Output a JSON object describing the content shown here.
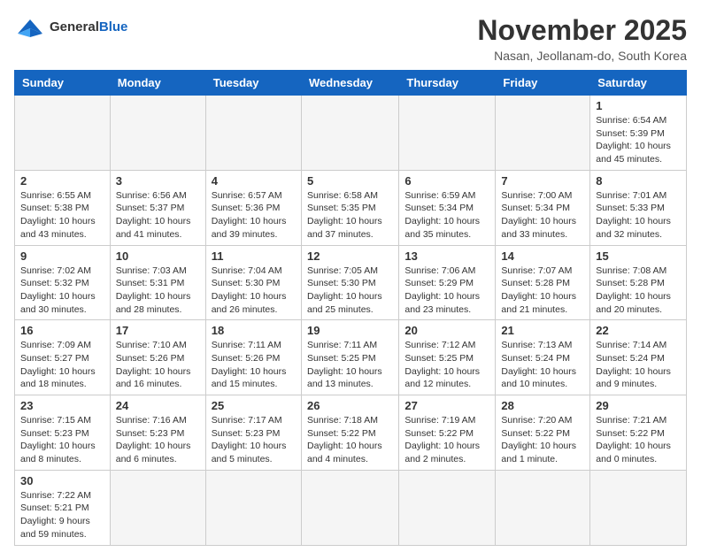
{
  "logo": {
    "text_general": "General",
    "text_blue": "Blue"
  },
  "header": {
    "month_title": "November 2025",
    "subtitle": "Nasan, Jeollanam-do, South Korea"
  },
  "weekdays": [
    "Sunday",
    "Monday",
    "Tuesday",
    "Wednesday",
    "Thursday",
    "Friday",
    "Saturday"
  ],
  "weeks": [
    [
      {
        "day": "",
        "info": ""
      },
      {
        "day": "",
        "info": ""
      },
      {
        "day": "",
        "info": ""
      },
      {
        "day": "",
        "info": ""
      },
      {
        "day": "",
        "info": ""
      },
      {
        "day": "",
        "info": ""
      },
      {
        "day": "1",
        "info": "Sunrise: 6:54 AM\nSunset: 5:39 PM\nDaylight: 10 hours and 45 minutes."
      }
    ],
    [
      {
        "day": "2",
        "info": "Sunrise: 6:55 AM\nSunset: 5:38 PM\nDaylight: 10 hours and 43 minutes."
      },
      {
        "day": "3",
        "info": "Sunrise: 6:56 AM\nSunset: 5:37 PM\nDaylight: 10 hours and 41 minutes."
      },
      {
        "day": "4",
        "info": "Sunrise: 6:57 AM\nSunset: 5:36 PM\nDaylight: 10 hours and 39 minutes."
      },
      {
        "day": "5",
        "info": "Sunrise: 6:58 AM\nSunset: 5:35 PM\nDaylight: 10 hours and 37 minutes."
      },
      {
        "day": "6",
        "info": "Sunrise: 6:59 AM\nSunset: 5:34 PM\nDaylight: 10 hours and 35 minutes."
      },
      {
        "day": "7",
        "info": "Sunrise: 7:00 AM\nSunset: 5:34 PM\nDaylight: 10 hours and 33 minutes."
      },
      {
        "day": "8",
        "info": "Sunrise: 7:01 AM\nSunset: 5:33 PM\nDaylight: 10 hours and 32 minutes."
      }
    ],
    [
      {
        "day": "9",
        "info": "Sunrise: 7:02 AM\nSunset: 5:32 PM\nDaylight: 10 hours and 30 minutes."
      },
      {
        "day": "10",
        "info": "Sunrise: 7:03 AM\nSunset: 5:31 PM\nDaylight: 10 hours and 28 minutes."
      },
      {
        "day": "11",
        "info": "Sunrise: 7:04 AM\nSunset: 5:30 PM\nDaylight: 10 hours and 26 minutes."
      },
      {
        "day": "12",
        "info": "Sunrise: 7:05 AM\nSunset: 5:30 PM\nDaylight: 10 hours and 25 minutes."
      },
      {
        "day": "13",
        "info": "Sunrise: 7:06 AM\nSunset: 5:29 PM\nDaylight: 10 hours and 23 minutes."
      },
      {
        "day": "14",
        "info": "Sunrise: 7:07 AM\nSunset: 5:28 PM\nDaylight: 10 hours and 21 minutes."
      },
      {
        "day": "15",
        "info": "Sunrise: 7:08 AM\nSunset: 5:28 PM\nDaylight: 10 hours and 20 minutes."
      }
    ],
    [
      {
        "day": "16",
        "info": "Sunrise: 7:09 AM\nSunset: 5:27 PM\nDaylight: 10 hours and 18 minutes."
      },
      {
        "day": "17",
        "info": "Sunrise: 7:10 AM\nSunset: 5:26 PM\nDaylight: 10 hours and 16 minutes."
      },
      {
        "day": "18",
        "info": "Sunrise: 7:11 AM\nSunset: 5:26 PM\nDaylight: 10 hours and 15 minutes."
      },
      {
        "day": "19",
        "info": "Sunrise: 7:11 AM\nSunset: 5:25 PM\nDaylight: 10 hours and 13 minutes."
      },
      {
        "day": "20",
        "info": "Sunrise: 7:12 AM\nSunset: 5:25 PM\nDaylight: 10 hours and 12 minutes."
      },
      {
        "day": "21",
        "info": "Sunrise: 7:13 AM\nSunset: 5:24 PM\nDaylight: 10 hours and 10 minutes."
      },
      {
        "day": "22",
        "info": "Sunrise: 7:14 AM\nSunset: 5:24 PM\nDaylight: 10 hours and 9 minutes."
      }
    ],
    [
      {
        "day": "23",
        "info": "Sunrise: 7:15 AM\nSunset: 5:23 PM\nDaylight: 10 hours and 8 minutes."
      },
      {
        "day": "24",
        "info": "Sunrise: 7:16 AM\nSunset: 5:23 PM\nDaylight: 10 hours and 6 minutes."
      },
      {
        "day": "25",
        "info": "Sunrise: 7:17 AM\nSunset: 5:23 PM\nDaylight: 10 hours and 5 minutes."
      },
      {
        "day": "26",
        "info": "Sunrise: 7:18 AM\nSunset: 5:22 PM\nDaylight: 10 hours and 4 minutes."
      },
      {
        "day": "27",
        "info": "Sunrise: 7:19 AM\nSunset: 5:22 PM\nDaylight: 10 hours and 2 minutes."
      },
      {
        "day": "28",
        "info": "Sunrise: 7:20 AM\nSunset: 5:22 PM\nDaylight: 10 hours and 1 minute."
      },
      {
        "day": "29",
        "info": "Sunrise: 7:21 AM\nSunset: 5:22 PM\nDaylight: 10 hours and 0 minutes."
      }
    ],
    [
      {
        "day": "30",
        "info": "Sunrise: 7:22 AM\nSunset: 5:21 PM\nDaylight: 9 hours and 59 minutes."
      },
      {
        "day": "",
        "info": ""
      },
      {
        "day": "",
        "info": ""
      },
      {
        "day": "",
        "info": ""
      },
      {
        "day": "",
        "info": ""
      },
      {
        "day": "",
        "info": ""
      },
      {
        "day": "",
        "info": ""
      }
    ]
  ]
}
